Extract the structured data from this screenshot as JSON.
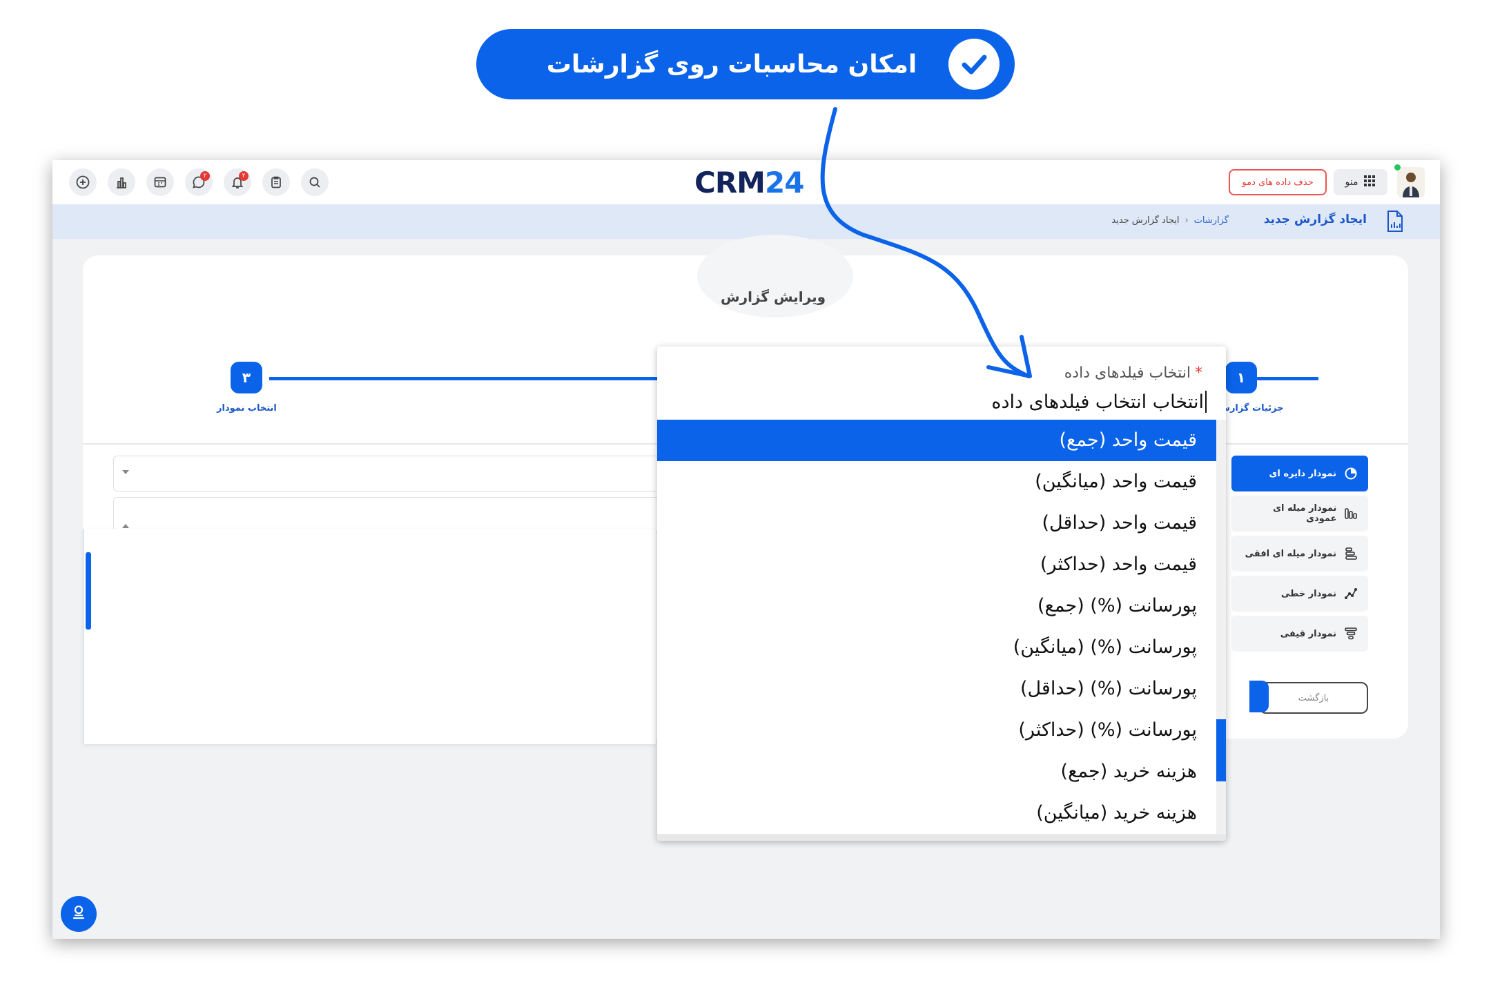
{
  "banner": {
    "title": "امکان محاسبات روی گزارشات"
  },
  "topbar": {
    "logo_left": "CRM",
    "logo_right": "24",
    "demo_button": "حذف داده های دمو",
    "menu_label": "منو",
    "badge_chat": "۲",
    "badge_bell": "۲"
  },
  "subbar": {
    "title": "ایجاد گزارش جدید",
    "breadcrumb": [
      "گزارشات",
      "ایجاد گزارش جدید"
    ]
  },
  "card": {
    "title": "ویرایش گزارش",
    "steps": [
      {
        "num": "۱",
        "label": "جزئیات گزارش"
      },
      {
        "num": "۳",
        "label": "انتخاب نمودار"
      }
    ]
  },
  "chart_types": [
    {
      "label": "نمودار دایره ای",
      "icon": "pie-chart-icon",
      "active": true
    },
    {
      "label": "نمودار میله ای عمودی",
      "icon": "bar-chart-icon",
      "active": false
    },
    {
      "label": "نمودار میله ای افقی",
      "icon": "hbar-chart-icon",
      "active": false
    },
    {
      "label": "نمودار خطی",
      "icon": "line-chart-icon",
      "active": false
    },
    {
      "label": "نمودار قیفی",
      "icon": "funnel-chart-icon",
      "active": false
    }
  ],
  "buttons": {
    "back": "بازگشت"
  },
  "dropdown": {
    "label": "انتخاب فیلدهای داده",
    "required_mark": "*",
    "input_value": "انتخاب انتخاب فیلدهای داده",
    "options": [
      "قیمت واحد (جمع)",
      "قیمت واحد (میانگین)",
      "قیمت واحد (حداقل)",
      "قیمت واحد (حداکثر)",
      "پورسانت (%) (جمع)",
      "پورسانت (%) (میانگین)",
      "پورسانت (%) (حداقل)",
      "پورسانت (%) (حداکثر)",
      "هزینه خرید (جمع)",
      "هزینه خرید (میانگین)"
    ],
    "selected_index": 0
  },
  "colors": {
    "brand": "#0a63e8",
    "danger": "#e53935"
  }
}
